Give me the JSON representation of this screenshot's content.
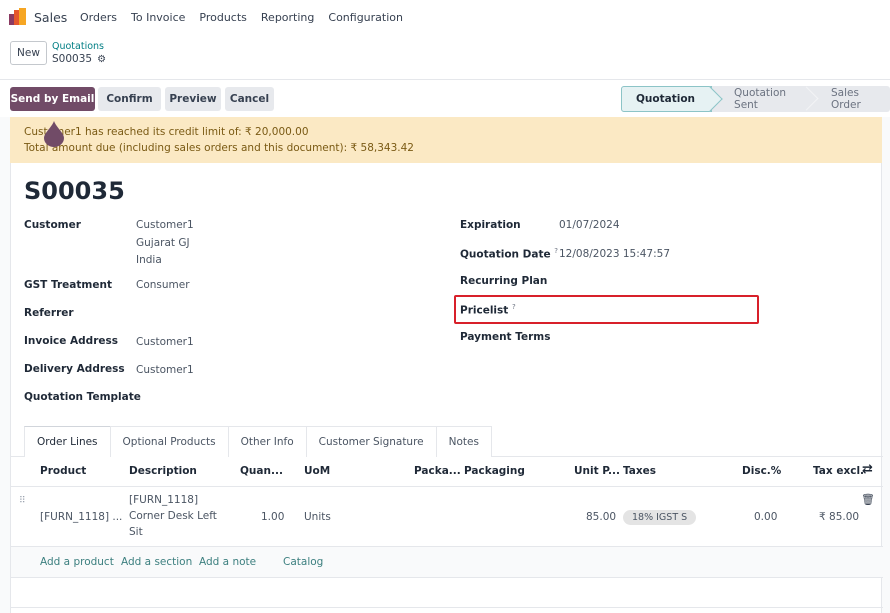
{
  "app": {
    "name": "Sales",
    "brand_color": "#714b67"
  },
  "menu": [
    "Orders",
    "To Invoice",
    "Products",
    "Reporting",
    "Configuration"
  ],
  "control": {
    "new_label": "New",
    "breadcrumb_parent": "Quotations",
    "breadcrumb_current": "S00035",
    "gear_icon": "gear-icon"
  },
  "actions": {
    "send_email": "Send by Email",
    "confirm": "Confirm",
    "preview": "Preview",
    "cancel": "Cancel"
  },
  "status_stages": [
    "Quotation",
    "Quotation Sent",
    "Sales Order"
  ],
  "status_active": "Quotation",
  "alert": {
    "line1": "Customer1 has reached its credit limit of: ₹ 20,000.00",
    "line2": "Total amount due (including sales orders and this document): ₹ 58,343.42"
  },
  "record": {
    "title": "S00035",
    "left_fields": {
      "customer_label": "Customer",
      "customer_name": "Customer1",
      "customer_state": "Gujarat GJ",
      "customer_country": "India",
      "gst_label": "GST Treatment",
      "gst_value": "Consumer",
      "referrer_label": "Referrer",
      "invoice_label": "Invoice Address",
      "invoice_value": "Customer1",
      "delivery_label": "Delivery Address",
      "delivery_value": "Customer1",
      "template_label": "Quotation Template"
    },
    "right_fields": {
      "expiration_label": "Expiration",
      "expiration_value": "01/07/2024",
      "quotation_date_label": "Quotation Date",
      "quotation_date_value": "12/08/2023 15:47:57",
      "recurring_label": "Recurring Plan",
      "pricelist_label": "Pricelist",
      "payment_terms_label": "Payment Terms",
      "help_mark": "?"
    }
  },
  "tabs": [
    "Order Lines",
    "Optional Products",
    "Other Info",
    "Customer Signature",
    "Notes"
  ],
  "table": {
    "headers": [
      "Product",
      "Description",
      "Quan...",
      "UoM",
      "Packa...",
      "Packaging",
      "Unit P...",
      "Taxes",
      "Disc.%",
      "Tax excl."
    ],
    "rows": [
      {
        "product": "[FURN_1118] ...",
        "description_1": "[FURN_1118]",
        "description_2": "Corner Desk Left",
        "description_3": "Sit",
        "quantity": "1.00",
        "uom": "Units",
        "unit_price": "85.00",
        "tax": "18% IGST S",
        "discount": "0.00",
        "subtotal": "₹ 85.00"
      }
    ],
    "add_links": [
      "Add a product",
      "Add a section",
      "Add a note",
      "Catalog"
    ]
  },
  "highlight_color": "#d8202a"
}
